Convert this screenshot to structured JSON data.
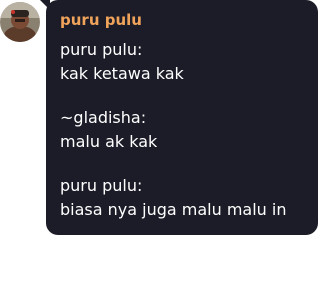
{
  "message": {
    "sender_name": "puru pulu",
    "sender_color": "#f0a35a",
    "bubble_color": "#1c1c28",
    "avatar_icon": "user-avatar-photo",
    "quote_blocks": [
      {
        "author": "puru pulu:",
        "text": "kak ketawa kak"
      },
      {
        "author": "~gladisha:",
        "text": "malu ak kak"
      },
      {
        "author": "puru pulu:",
        "text": "biasa nya juga malu malu in"
      }
    ]
  }
}
